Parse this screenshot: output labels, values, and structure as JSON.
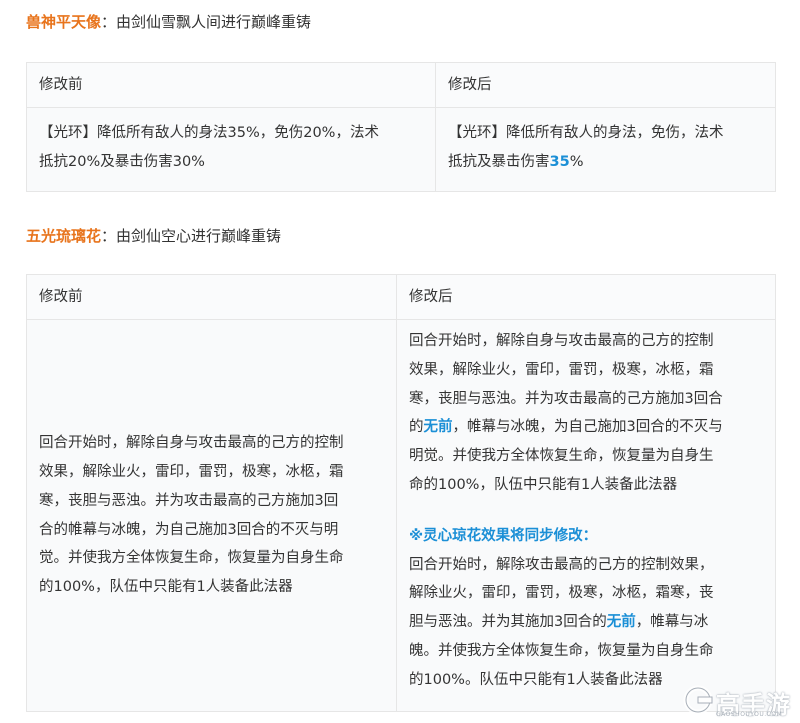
{
  "section1": {
    "name": "兽神平天像",
    "desc": "：由剑仙雪飘人间进行巅峰重铸",
    "headers": [
      "修改前",
      "修改后"
    ],
    "before": [
      "【光环】降低所有敌人的身法35%，免伤20%，法术",
      "抵抗20%及暴击伤害30%"
    ],
    "after": [
      "【光环】降低所有敌人的身法，免伤，法术",
      "抵抗及暴击伤害"
    ],
    "after_hl": "35",
    "after_tail": "%"
  },
  "section2": {
    "name": "五光琉璃花",
    "desc": "：由剑仙空心进行巅峰重铸",
    "headers": [
      "修改前",
      "修改后"
    ],
    "before": [
      "回合开始时，解除自身与攻击最高的己方的控制",
      "效果，解除业火，雷印，雷罚，极寒，冰柩，霜",
      "寒，丧胆与恶浊。并为攻击最高的己方施加3回",
      "合的帷幕与冰魄，为自己施加3回合的不灭与明",
      "觉。并使我方全体恢复生命，恢复量为自身生命",
      "的100%，队伍中只能有1人装备此法器"
    ],
    "after": {
      "l1": "回合开始时，解除自身与攻击最高的己方的控制",
      "l2": "效果，解除业火，雷印，雷罚，极寒，冰柩，霜",
      "l3": "寒，丧胆与恶浊。并为攻击最高的己方施加3回合",
      "l4_pre": "的",
      "l4_hl": "无前",
      "l4_post": "，帷幕与冰魄，为自己施加3回合的不灭与",
      "l5": "明觉。并使我方全体恢复生命，恢复量为自身生",
      "l6": "命的100%，队伍中只能有1人装备此法器",
      "note_title": "※灵心琼花效果将同步修改：",
      "n1": "回合开始时，解除攻击最高的己方的控制效果，",
      "n2": "解除业火，雷印，雷罚，极寒，冰柩，霜寒，丧",
      "n3_pre": "胆与恶浊。并为其施加3回合的",
      "n3_hl": "无前",
      "n3_post": "，帷幕与冰",
      "n4": "魄。并使我方全体恢复生命，恢复量为自身生命",
      "n5": "的100%。队伍中只能有1人装备此法器"
    }
  },
  "watermark": {
    "text": "高手游",
    "sub": "GAOSHOUYOU.COM"
  }
}
